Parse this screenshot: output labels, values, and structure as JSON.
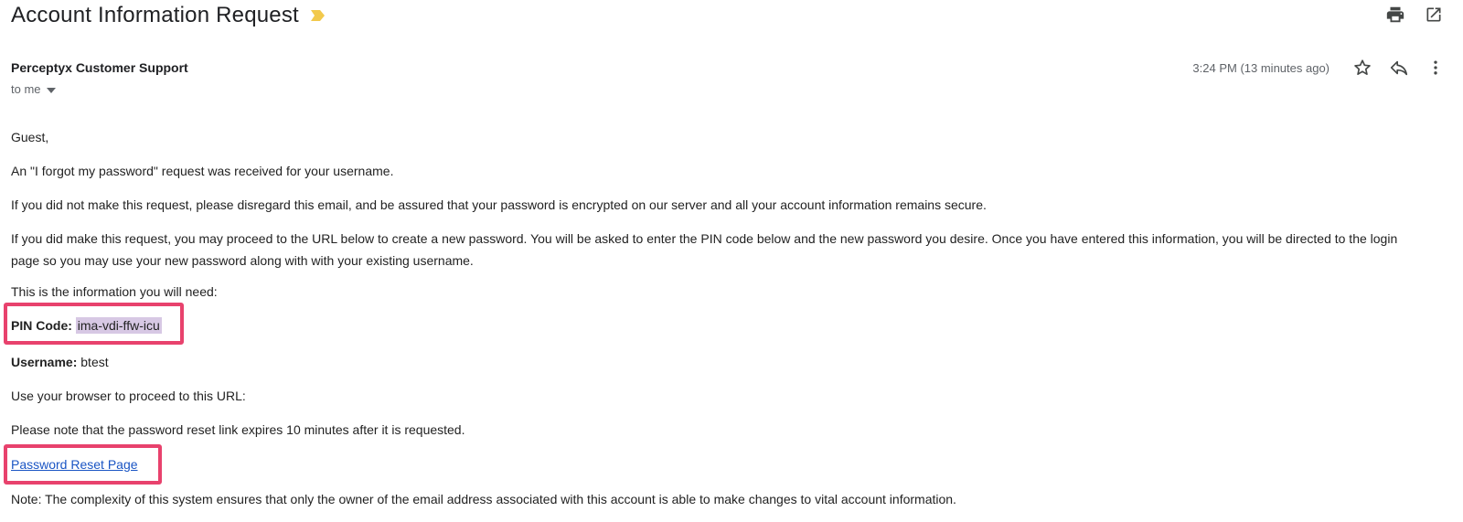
{
  "email": {
    "subject": "Account Information Request",
    "sender": "Perceptyx Customer Support",
    "recipient": "to me",
    "timestamp": "3:24 PM (13 minutes ago)"
  },
  "icons": {
    "importance": "importance-marker-icon",
    "print": "print-icon",
    "open_new_window": "open-in-new-window-icon",
    "star": "star-icon",
    "reply": "reply-icon",
    "more": "more-vert-icon",
    "recipient_dropdown": "chevron-down-icon"
  },
  "colors": {
    "highlight_border": "#e8426d",
    "pin_highlight": "#d7c8e4",
    "link": "#1a55c4",
    "importance": "#f2c94c"
  },
  "body": {
    "greeting": "Guest,",
    "request_received": "An \"I forgot my password\" request was received for your username.",
    "disregard_notice": "If you did not make this request, please disregard this email, and be assured that your password is encrypted on our server and all your account information remains secure.",
    "proceed_instructions": "If you did make this request, you may proceed to the URL below to create a new password. You will be asked to enter the PIN code below and the new password you desire. Once you have entered this information, you will be directed to the login page so you may use your new password along with with your existing username.",
    "info_intro": "This is the information you will need:",
    "pin_label": "PIN Code:",
    "pin_value": "ima-vdi-ffw-icu",
    "username_label": "Username:",
    "username_value": "btest",
    "url_instruction": "Use your browser to proceed to this URL:",
    "expiry_note": "Please note that the password reset link expires 10 minutes after it is requested.",
    "reset_link_text": "Password Reset Page",
    "complexity_note": "Note: The complexity of this system ensures that only the owner of the email address associated with this account is able to make changes to vital account information."
  }
}
